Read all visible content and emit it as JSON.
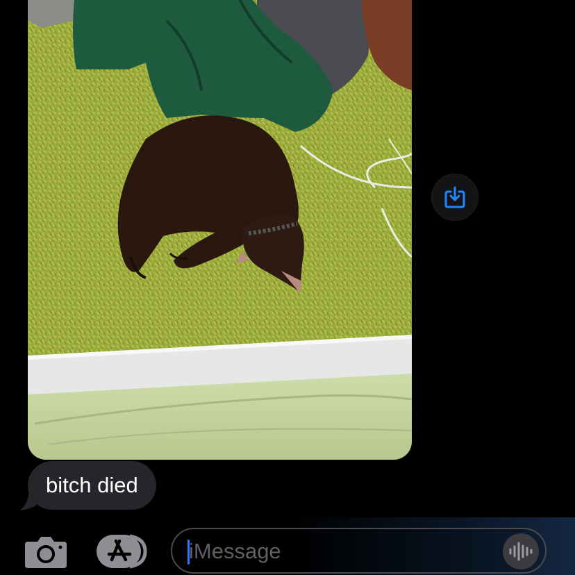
{
  "conversation": {
    "messages": [
      {
        "kind": "photo",
        "alt": "Photo attachment"
      },
      {
        "kind": "text",
        "text": "bitch died"
      }
    ]
  },
  "compose": {
    "placeholder": "iMessage"
  },
  "icons": {
    "save": "save-to-photos-icon",
    "camera": "camera-icon",
    "apps": "app-store-icon",
    "voice": "waveform-icon"
  },
  "colors": {
    "background": "#000000",
    "bubble_received": "#26262a",
    "accent": "#2d7cf6",
    "save_icon": "#1e88ff"
  }
}
